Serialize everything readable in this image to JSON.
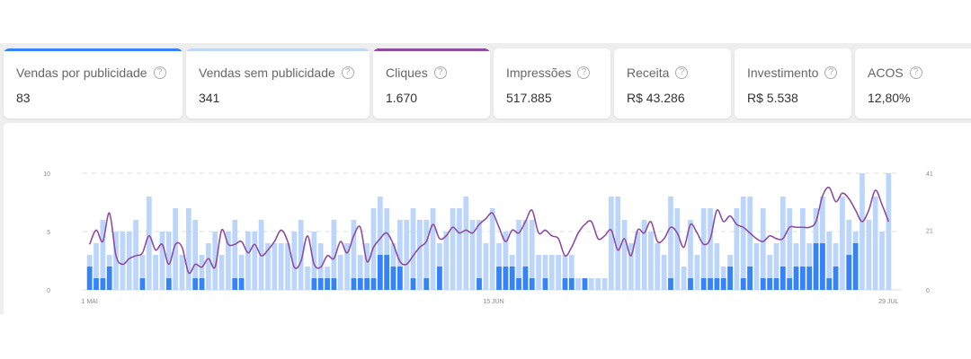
{
  "metrics": [
    {
      "label": "Vendas por publicidade",
      "value": "83",
      "accent": "#3483fa"
    },
    {
      "label": "Vendas sem publicidade",
      "value": "341",
      "accent": "#c1d7f5"
    },
    {
      "label": "Cliques",
      "value": "1.670",
      "accent": "#8e4c9e"
    },
    {
      "label": "Impressões",
      "value": "517.885",
      "accent": ""
    },
    {
      "label": "Receita",
      "value": "R$ 43.286",
      "accent": ""
    },
    {
      "label": "Investimento",
      "value": "R$ 5.538",
      "accent": ""
    },
    {
      "label": "ACOS",
      "value": "12,80%",
      "accent": ""
    }
  ],
  "help_icon": "question-circle-icon",
  "colors": {
    "ads_bar": "#3483fa",
    "organic_bar": "#bcd6fb",
    "clicks_line": "#8e4c9e",
    "grid": "#dddddd",
    "tick": "#888888"
  },
  "chart_data": {
    "type": "bar",
    "grid": "horizontal dashed",
    "x_ticks": [
      "1 MAI",
      "15 JUN",
      "29 JUL"
    ],
    "x_start": "2024-05-01",
    "x_end": "2024-07-29",
    "y_left": {
      "ticks": [
        0,
        5,
        10
      ],
      "ylim": [
        0,
        10
      ]
    },
    "y_right": {
      "ticks": [
        0,
        21,
        41
      ],
      "ylim": [
        0,
        41
      ]
    },
    "ads_sales": [
      2,
      1,
      1,
      2,
      0,
      0,
      0,
      0,
      1,
      0,
      0,
      0,
      1,
      0,
      0,
      0,
      1,
      1,
      0,
      0,
      0,
      0,
      1,
      1,
      0,
      0,
      0,
      0,
      0,
      0,
      0,
      0,
      0,
      0,
      1,
      1,
      1,
      1,
      0,
      0,
      1,
      1,
      1,
      1,
      3,
      3,
      2,
      2,
      0,
      1,
      0,
      1,
      0,
      2,
      0,
      0,
      0,
      0,
      0,
      1,
      0,
      0,
      2,
      2,
      2,
      1,
      2,
      1,
      0,
      1,
      0,
      0,
      1,
      1,
      0,
      1,
      0,
      0,
      0,
      0,
      0,
      0,
      0,
      0,
      0,
      0,
      0,
      0,
      1,
      0,
      0,
      1,
      0,
      1,
      1,
      1,
      1,
      2,
      0,
      1,
      2,
      0,
      1,
      1,
      1,
      2,
      1,
      2,
      2,
      2,
      4,
      4,
      1,
      2,
      0,
      3,
      4
    ],
    "total_sales": [
      3,
      4,
      6,
      3,
      5,
      5,
      5,
      6,
      3,
      8,
      3,
      5,
      5,
      7,
      3,
      7,
      6,
      3,
      4,
      5,
      3,
      5,
      6,
      3,
      5,
      5,
      6,
      4,
      4,
      4,
      4,
      5,
      6,
      2,
      5,
      4,
      2,
      6,
      3,
      4,
      6,
      3,
      4,
      7,
      8,
      7,
      4,
      6,
      6,
      7,
      6,
      6,
      7,
      4,
      5,
      7,
      7,
      8,
      6,
      6,
      4,
      7,
      4,
      5,
      3,
      6,
      6,
      6,
      3,
      3,
      3,
      3,
      3,
      3,
      1,
      1,
      1,
      1,
      1,
      8,
      8,
      6,
      4,
      5,
      6,
      5,
      4,
      3,
      8,
      7,
      2,
      6,
      3,
      7,
      7,
      4,
      2,
      3,
      7,
      8,
      8,
      4,
      7,
      3,
      4,
      8,
      7,
      4,
      7,
      4,
      7,
      8,
      5,
      4,
      8,
      6,
      5,
      10,
      6,
      8,
      5,
      10
    ],
    "clicks": [
      16,
      21,
      17,
      27,
      12,
      9,
      11,
      12,
      13,
      19,
      14,
      16,
      9,
      16,
      15,
      6,
      9,
      8,
      11,
      8,
      21,
      16,
      16,
      17,
      13,
      16,
      12,
      14,
      17,
      21,
      17,
      8,
      10,
      19,
      9,
      8,
      12,
      11,
      17,
      13,
      19,
      22,
      10,
      15,
      18,
      20,
      16,
      10,
      9,
      12,
      15,
      17,
      23,
      18,
      19,
      22,
      20,
      21,
      20,
      23,
      25,
      27,
      22,
      17,
      21,
      20,
      24,
      28,
      20,
      21,
      19,
      18,
      12,
      15,
      20,
      23,
      24,
      18,
      19,
      21,
      14,
      18,
      12,
      21,
      20,
      24,
      17,
      18,
      22,
      20,
      15,
      23,
      20,
      16,
      18,
      28,
      24,
      26,
      23,
      22,
      20,
      18,
      17,
      19,
      18,
      18,
      22,
      22,
      22,
      22,
      24,
      33,
      36,
      31,
      34,
      32,
      28,
      24,
      28,
      35,
      30,
      24
    ],
    "series": [
      {
        "name": "Vendas por publicidade"
      },
      {
        "name": "Vendas sem publicidade"
      },
      {
        "name": "Cliques"
      }
    ]
  }
}
